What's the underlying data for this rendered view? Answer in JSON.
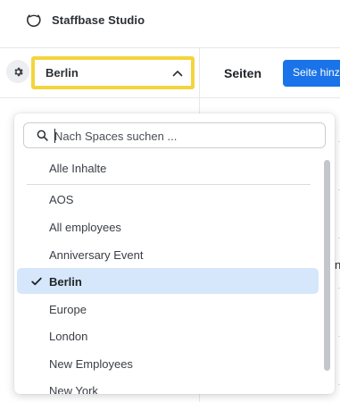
{
  "app": {
    "title": "Staffbase Studio"
  },
  "sidebar": {
    "space_selector": {
      "value": "Berlin"
    }
  },
  "main": {
    "title": "Seiten",
    "primary_button_label": "Seite hinzufügen",
    "clipped_char": "n"
  },
  "dropdown": {
    "search": {
      "placeholder": "Nach Spaces suchen ...",
      "value": ""
    },
    "all_content": "Alle Inhalte",
    "options": [
      {
        "label": "AOS",
        "selected": false
      },
      {
        "label": "All employees",
        "selected": false
      },
      {
        "label": "Anniversary Event",
        "selected": false
      },
      {
        "label": "Berlin",
        "selected": true
      },
      {
        "label": "Europe",
        "selected": false
      },
      {
        "label": "London",
        "selected": false
      },
      {
        "label": "New Employees",
        "selected": false
      },
      {
        "label": "New York",
        "selected": false
      }
    ]
  },
  "colors": {
    "accent": "#1a73e8",
    "highlight_border": "#f4d43d",
    "selected_background": "#d6e7fb"
  },
  "icons": {
    "logo": "staffbase-logo-icon",
    "gear": "gear-icon",
    "chevron": "chevron-up-icon",
    "search": "search-icon",
    "check": "check-icon"
  }
}
